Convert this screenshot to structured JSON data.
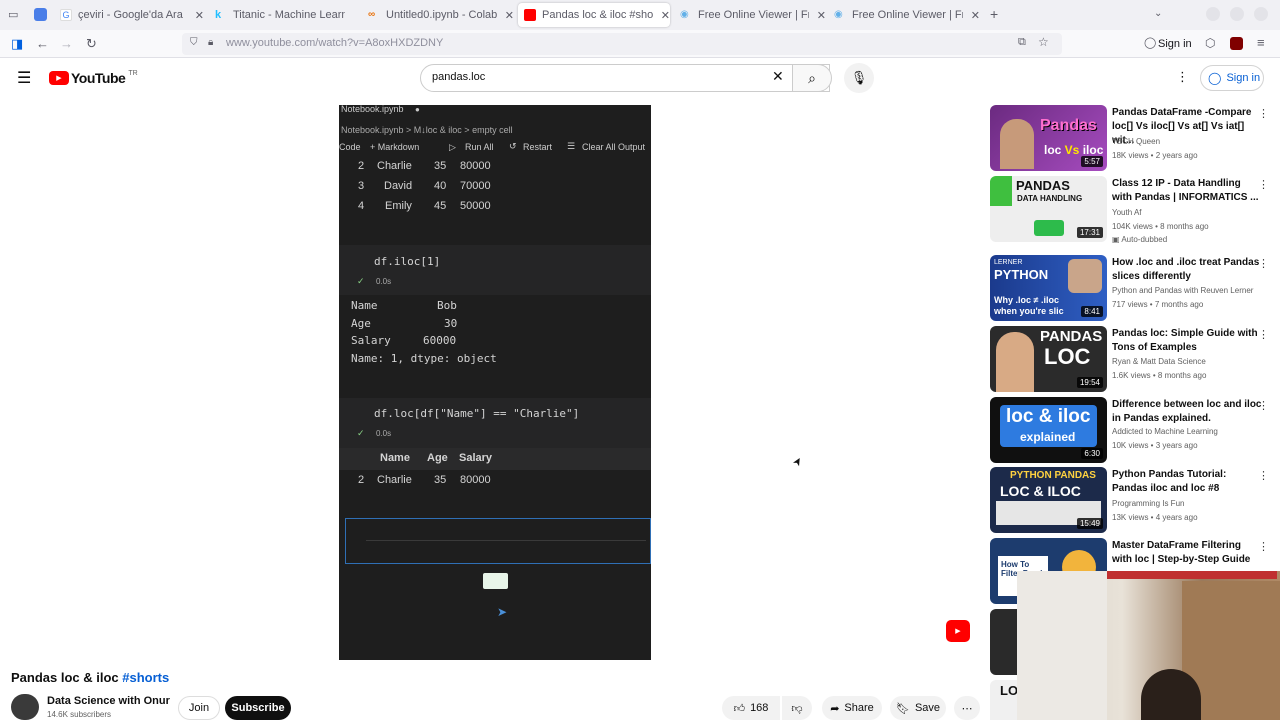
{
  "browser": {
    "tabs": [
      {
        "title": "çeviri - Google'da Ara",
        "color": "#4285f4"
      },
      {
        "title": "Titanic - Machine Learning",
        "color": "#20beff"
      },
      {
        "title": "Untitled0.ipynb - Colab",
        "color": "#f9ab00"
      },
      {
        "title": "Pandas loc & iloc #shorts",
        "color": "#ff0000"
      },
      {
        "title": "Free Online Viewer | Free",
        "color": "#62b0e8"
      },
      {
        "title": "Free Online Viewer | Free",
        "color": "#62b0e8"
      }
    ],
    "url": "www.youtube.com/watch?v=A8oxHXDZDNY",
    "sign_in": "Sign in"
  },
  "youtube": {
    "logo": "YouTube",
    "region": "TR",
    "search_value": "pandas.loc",
    "sign_in": "Sign in"
  },
  "video": {
    "filename": "Notebook.ipynb",
    "breadcrumb": "Notebook.ipynb > M↓loc & iloc > empty cell",
    "toolbar": {
      "code": "Code",
      "markdown": "+ Markdown",
      "run_all": "Run All",
      "restart": "Restart",
      "clear": "Clear All Output"
    },
    "rows1": [
      {
        "idx": "2",
        "name": "Charlie",
        "age": "35",
        "salary": "80000"
      },
      {
        "idx": "3",
        "name": "David",
        "age": "40",
        "salary": "70000"
      },
      {
        "idx": "4",
        "name": "Emily",
        "age": "45",
        "salary": "50000"
      }
    ],
    "cell1_code": "df.iloc[1]",
    "cell1_time": "0.0s",
    "series_out": [
      {
        "k": "Name",
        "v": "Bob"
      },
      {
        "k": "Age",
        "v": "30"
      },
      {
        "k": "Salary",
        "v": "60000"
      }
    ],
    "series_footer": "Name: 1, dtype: object",
    "cell2_code": "df.loc[df[\"Name\"] == \"Charlie\"]",
    "cell2_time": "0.0s",
    "cols": [
      "Name",
      "Age",
      "Salary"
    ],
    "row2": {
      "idx": "2",
      "name": "Charlie",
      "age": "35",
      "salary": "80000"
    }
  },
  "title": "Pandas loc & iloc",
  "hashtag": "#shorts",
  "channel": {
    "name": "Data Science with Onur",
    "subs": "14.6K subscribers",
    "join": "Join",
    "subscribe": "Subscribe"
  },
  "actions": {
    "likes": "168",
    "share": "Share",
    "save": "Save"
  },
  "recommendations": [
    {
      "title": "Pandas DataFrame -Compare loc[] Vs iloc[] Vs at[] Vs iat[] wit...",
      "channel": "TECH Queen",
      "meta": "18K views • 2 years ago",
      "duration": "5:57",
      "thumb_text": "Pandas loc Vs iloc",
      "bg": "#7a2d8f"
    },
    {
      "title": "Class 12 IP - Data Handling with Pandas | INFORMATICS ...",
      "channel": "Youth Af",
      "meta": "104K views • 8 months ago",
      "badge": "Auto-dubbed",
      "duration": "17:31",
      "thumb_text": "PANDAS DATA HANDLING",
      "bg": "#e8e8e8"
    },
    {
      "title": "How .loc and .iloc treat Pandas slices differently",
      "channel": "Python and Pandas with Reuven Lerner",
      "meta": "717 views • 7 months ago",
      "duration": "8:41",
      "thumb_text": "Why .loc ≠ .iloc when you're slicing",
      "bg": "#1b3a8c"
    },
    {
      "title": "Pandas loc: Simple Guide with Tons of Examples",
      "channel": "Ryan & Matt Data Science",
      "meta": "1.6K views • 8 months ago",
      "duration": "19:54",
      "thumb_text": "PANDAS LOC",
      "bg": "#2b2b2b"
    },
    {
      "title": "Difference between loc and iloc in Pandas explained.",
      "channel": "Addicted to Machine Learning",
      "meta": "10K views • 3 years ago",
      "duration": "6:30",
      "thumb_text": "loc & iloc explained",
      "bg": "#111111"
    },
    {
      "title": "Python Pandas Tutorial: Pandas iloc and loc #8",
      "channel": "Programming Is Fun",
      "meta": "13K views • 4 years ago",
      "duration": "15:49",
      "thumb_text": "PYTHON PANDAS LOC & ILOC",
      "bg": "#1c2a4a"
    },
    {
      "title": "Master DataFrame Filtering with loc | Step-by-Step Guide",
      "channel": "",
      "meta": "",
      "duration": "",
      "thumb_text": "How To Filter Pandas",
      "bg": "#1d3c6e"
    }
  ]
}
